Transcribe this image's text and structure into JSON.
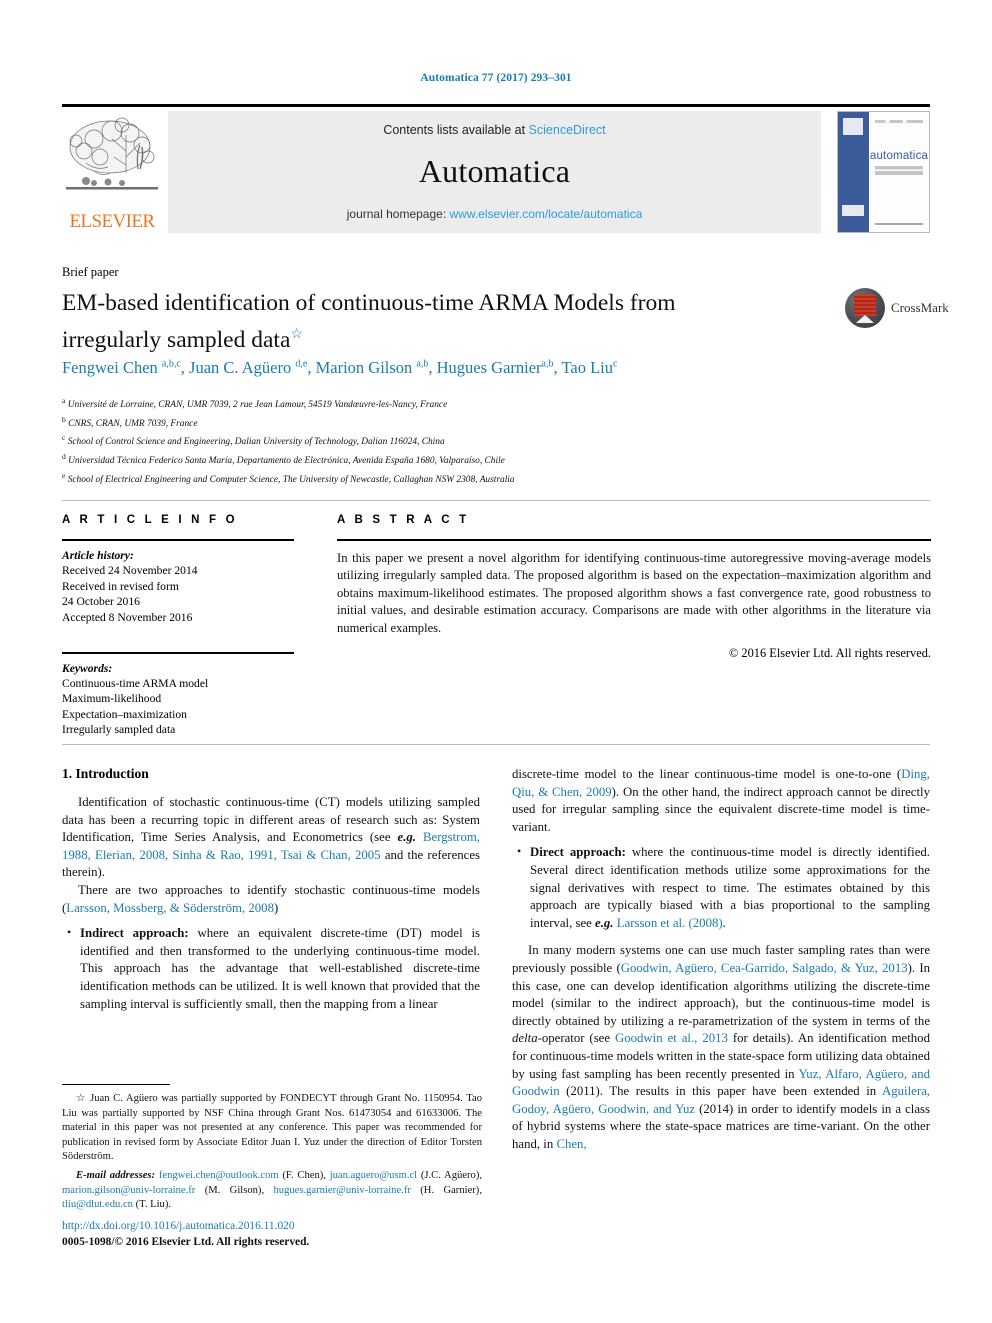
{
  "running_head": "Automatica 77 (2017) 293–301",
  "masthead": {
    "publisher_name": "ELSEVIER",
    "contents_prefix": "Contents lists available at ",
    "contents_link": "ScienceDirect",
    "journal_title": "Automatica",
    "homepage_prefix": "journal homepage: ",
    "homepage_url": "www.elsevier.com/locate/automatica",
    "cover_title": "automatica",
    "colors": {
      "link_blue": "#2e9bd6",
      "elsevier_orange": "#e87722",
      "band_gray": "#ececec",
      "cover_blue": "#3a5c9b"
    }
  },
  "article": {
    "type_label": "Brief paper",
    "title": "EM-based identification of continuous-time ARMA Models from irregularly sampled data",
    "title_footnote_marker": "☆",
    "crossmark_label": "CrossMark",
    "authors_html": "Fengwei Chen <sup>a,b,c</sup>, Juan C. Agüero <sup>d,e</sup>, Marion Gilson <sup>a,b</sup>, Hugues Garnier<sup>a,b</sup>, Tao Liu<sup>c</sup>",
    "affiliations": [
      {
        "marker": "a",
        "text": "Université de Lorraine, CRAN, UMR 7039, 2 rue Jean Lamour, 54519 Vandœuvre-les-Nancy, France"
      },
      {
        "marker": "b",
        "text": "CNRS, CRAN, UMR 7039, France"
      },
      {
        "marker": "c",
        "text": "School of Control Science and Engineering, Dalian University of Technology, Dalian 116024, China"
      },
      {
        "marker": "d",
        "text": "Universidad Técnica Federico Santa María, Departamento de Electrónica, Avenida España 1680, Valparaíso, Chile"
      },
      {
        "marker": "e",
        "text": "School of Electrical Engineering and Computer Science, The University of Newcastle, Callaghan NSW 2308, Australia"
      }
    ]
  },
  "article_info": {
    "heading": "A R T I C L E  I N F O",
    "history_label": "Article history:",
    "history": [
      "Received 24 November 2014",
      "Received in revised form",
      "24 October 2016",
      "Accepted 8 November 2016"
    ],
    "keywords_label": "Keywords:",
    "keywords": [
      "Continuous-time ARMA model",
      "Maximum-likelihood",
      "Expectation–maximization",
      "Irregularly sampled data"
    ]
  },
  "abstract": {
    "heading": "A B S T R A C T",
    "text": "In this paper we present a novel algorithm for identifying continuous-time autoregressive moving-average models utilizing irregularly sampled data. The proposed algorithm is based on the expectation–maximization algorithm and obtains maximum-likelihood estimates. The proposed algorithm shows a fast convergence rate, good robustness to initial values, and desirable estimation accuracy. Comparisons are made with other algorithms in the literature via numerical examples.",
    "copyright": "© 2016 Elsevier Ltd. All rights reserved."
  },
  "body": {
    "section_heading": "1. Introduction",
    "left": {
      "p1_a": "Identification of stochastic continuous-time (CT) models utilizing sampled data has been a recurring topic in different areas of research such as: System Identification, Time Series Analysis, and Econometrics (see ",
      "p1_eg": "e.g.",
      "p1_refs": " Bergstrom, 1988, Elerian, 2008, Sinha & Rao, 1991, Tsai & Chan, 2005",
      "p1_b": " and the references therein).",
      "p2_a": "There are two approaches to identify stochastic continuous-time models (",
      "p2_ref": "Larsson, Mossberg, & Söderström, 2008",
      "p2_b": ")",
      "bullet1_label": "Indirect approach:",
      "bullet1_text": " where an equivalent discrete-time (DT) model is identified and then transformed to the underlying continuous-time model. This approach has the advantage that well-established discrete-time identification methods can be utilized. It is well known that provided that the sampling interval is sufficiently small, then the mapping from a linear"
    },
    "right": {
      "bullet1_cont_a": "discrete-time model to the linear continuous-time model is one-to-one (",
      "bullet1_cont_ref": "Ding, Qiu, & Chen, 2009",
      "bullet1_cont_b": "). On the other hand, the indirect approach cannot be directly used for irregular sampling since the equivalent discrete-time model is time-variant.",
      "bullet2_label": "Direct approach:",
      "bullet2_text_a": " where the continuous-time model is directly identified. Several direct identification methods utilize some approximations for the signal derivatives with respect to time. The estimates obtained by this approach are typically biased with a bias proportional to the sampling interval, see ",
      "bullet2_eg": "e.g.",
      "bullet2_ref": " Larsson et al.",
      "bullet2_year": " (2008)",
      "bullet2_text_b": ".",
      "p3_a": "In many modern systems one can use much faster sampling rates than were previously possible (",
      "p3_ref1": "Goodwin, Agüero, Cea-Garrido, Salgado, & Yuz, 2013",
      "p3_b": "). In this case, one can develop identification algorithms utilizing the discrete-time model (similar to the indirect approach), but the continuous-time model is directly obtained by utilizing a re-parametrization of the system in terms of the ",
      "p3_delta": "delta",
      "p3_c": "-operator (see ",
      "p3_ref2": "Goodwin et al., 2013",
      "p3_d": " for details). An identification method for continuous-time models written in the state-space form utilizing data obtained by using fast sampling has been recently presented in ",
      "p3_ref3": "Yuz, Alfaro, Agüero, and Goodwin",
      "p3_e": " (2011). The results in this paper have been extended in ",
      "p3_ref4": "Aguilera, Godoy, Agüero, Goodwin, and Yuz",
      "p3_f": " (2014) in order to identify models in a class of hybrid systems where the state-space matrices are time-variant. On the other hand, in ",
      "p3_ref5": "Chen,"
    }
  },
  "footnote": {
    "marker": "☆",
    "text": "Juan C. Agüero was partially supported by FONDECYT through Grant No. 1150954. Tao Liu was partially supported by NSF China through Grant Nos. 61473054 and 61633006. The material in this paper was not presented at any conference. This paper was recommended for publication in revised form by Associate Editor Juan I. Yuz under the direction of Editor Torsten Söderström.",
    "emails_label": "E-mail addresses:",
    "emails": [
      {
        "address": "fengwei.chen@outlook.com",
        "name": "(F. Chen)"
      },
      {
        "address": "juan.aguero@usm.cl",
        "name": "(J.C. Agüero)"
      },
      {
        "address": "marion.gilson@univ-lorraine.fr",
        "name": "(M. Gilson)"
      },
      {
        "address": "hugues.garnier@univ-lorraine.fr",
        "name": "(H. Garnier)"
      },
      {
        "address": "tliu@dlut.edu.cn",
        "name": "(T. Liu)"
      }
    ]
  },
  "imprint": {
    "doi_url": "http://dx.doi.org/10.1016/j.automatica.2016.11.020",
    "issn_line": "0005-1098/© 2016 Elsevier Ltd. All rights reserved."
  }
}
